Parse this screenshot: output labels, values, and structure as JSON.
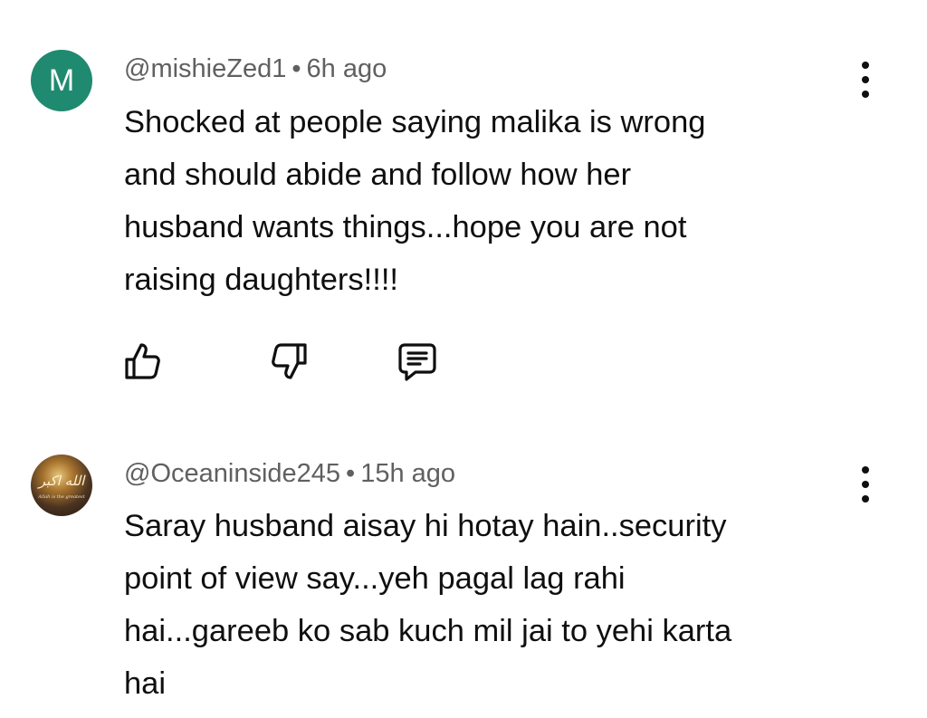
{
  "comments": [
    {
      "avatar_letter": "M",
      "avatar_color": "#1f8a70",
      "author": "@mishieZed1",
      "separator": "•",
      "time": "6h ago",
      "lines": [
        "Shocked at people saying malika is wrong",
        "and should abide and follow how her",
        "husband wants things...hope you are not",
        "raising daughters!!!!"
      ],
      "actions": [
        "like-icon",
        "dislike-icon",
        "reply-icon"
      ]
    },
    {
      "avatar_text": "الله اكبر",
      "avatar_subtext": "Allah is the greatest",
      "author": "@Oceaninside245",
      "separator": "•",
      "time": "15h ago",
      "lines": [
        "Saray husband aisay hi hotay hain..security",
        "point of view say...yeh pagal lag rahi",
        "hai...gareeb ko sab kuch mil jai to yehi karta",
        "hai"
      ]
    }
  ]
}
